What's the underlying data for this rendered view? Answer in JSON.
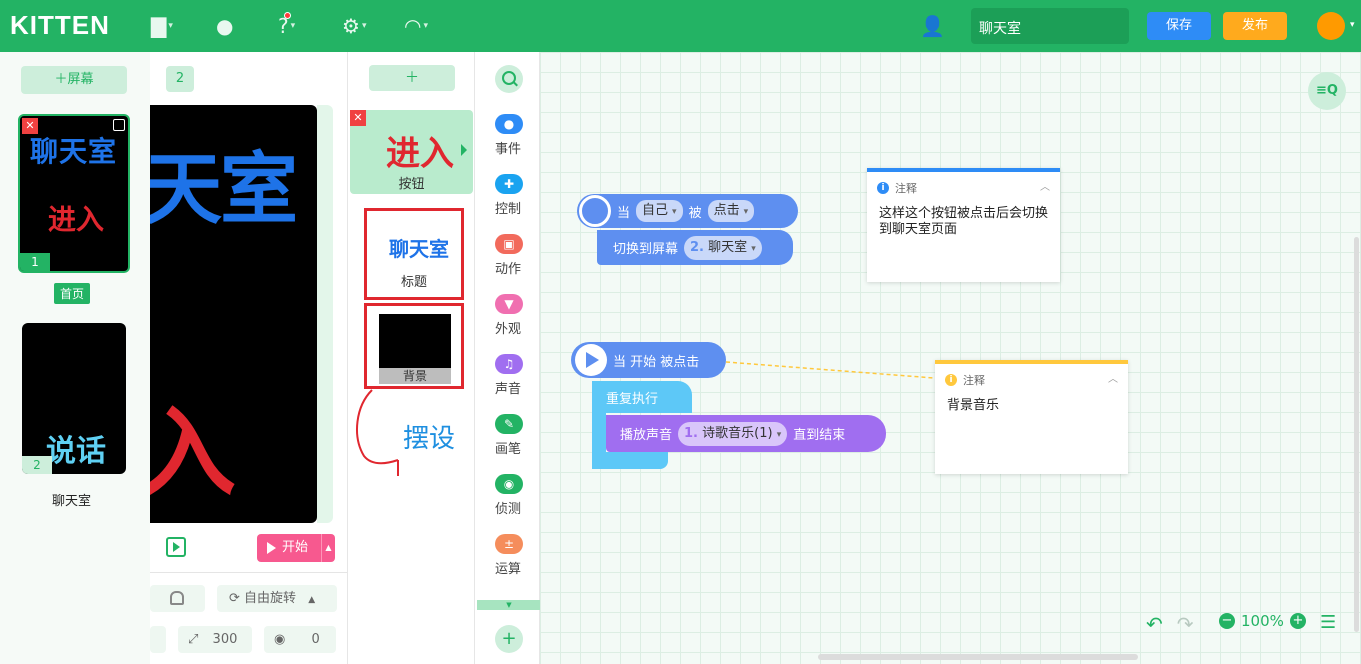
{
  "app": {
    "logo": "KITTEN"
  },
  "topbar": {
    "project_name": "聊天室",
    "save_label": "保存",
    "publish_label": "发布"
  },
  "screens": {
    "add_label": "＋屏幕",
    "items": [
      {
        "index": "1",
        "name": "首页",
        "title_text": "聊天室",
        "button_text": "进入"
      },
      {
        "index": "2",
        "name": "聊天室",
        "button_text": "说话"
      }
    ]
  },
  "stage": {
    "tab": "2",
    "big_title": "天室",
    "big_button": "入",
    "start_label": "开始",
    "rotate_label": "自由旋转",
    "size_value": "300",
    "direction_value": "0"
  },
  "actors": {
    "add_label": "＋",
    "items": [
      {
        "name": "按钮",
        "preview": "进入"
      },
      {
        "name": "标题",
        "preview": "聊天室"
      },
      {
        "name": "背景"
      }
    ],
    "annotation": "摆设"
  },
  "categories": [
    {
      "label": "事件",
      "color": "#2e8cf6"
    },
    {
      "label": "控制",
      "color": "#1aa3f0"
    },
    {
      "label": "动作",
      "color": "#f26a5c"
    },
    {
      "label": "外观",
      "color": "#f06fb0"
    },
    {
      "label": "声音",
      "color": "#a06ef0"
    },
    {
      "label": "画笔",
      "color": "#23b364"
    },
    {
      "label": "侦测",
      "color": "#23b364"
    },
    {
      "label": "运算",
      "color": "#f58d5c"
    }
  ],
  "workspace": {
    "search_label": "≡Q",
    "block1": {
      "when": "当",
      "self": "自己",
      "by": "被",
      "click": "点击",
      "switch": "切换到屏幕",
      "screen_num": "2.",
      "screen_name": "聊天室"
    },
    "block2": {
      "start": "当 开始 被点击",
      "repeat": "重复执行",
      "play": "播放声音",
      "sound_num": "1.",
      "sound_name": "诗歌音乐(1)",
      "until": "直到结束"
    },
    "note1": {
      "title": "注释",
      "body": "这样这个按钮被点击后会切换到聊天室页面",
      "color": "#2e8cf6"
    },
    "note2": {
      "title": "注释",
      "body": "背景音乐",
      "color": "#ffc83d"
    },
    "zoom": "100%"
  }
}
